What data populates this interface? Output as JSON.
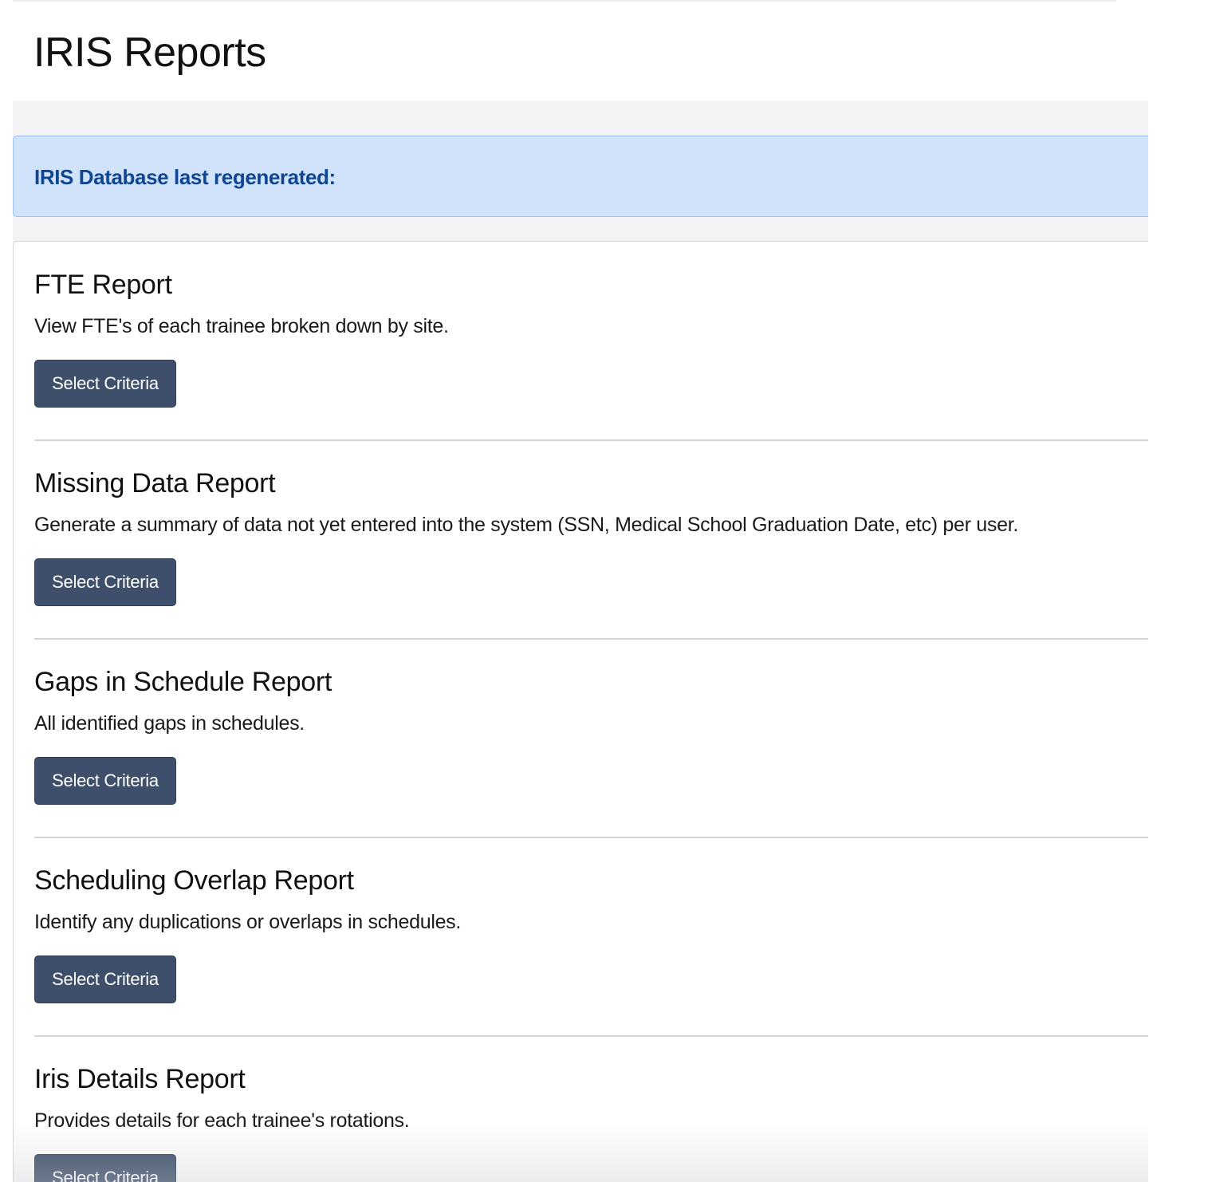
{
  "header": {
    "title": "IRIS Reports"
  },
  "alert": {
    "text": "IRIS Database last regenerated:"
  },
  "reports": [
    {
      "title": "FTE Report",
      "description": "View FTE's of each trainee broken down by site.",
      "button_label": "Select Criteria"
    },
    {
      "title": "Missing Data Report",
      "description": "Generate a summary of data not yet entered into the system (SSN, Medical School Graduation Date, etc) per user.",
      "button_label": "Select Criteria"
    },
    {
      "title": "Gaps in Schedule Report",
      "description": "All identified gaps in schedules.",
      "button_label": "Select Criteria"
    },
    {
      "title": "Scheduling Overlap Report",
      "description": "Identify any duplications or overlaps in schedules.",
      "button_label": "Select Criteria"
    },
    {
      "title": "Iris Details Report",
      "description": "Provides details for each trainee's rotations.",
      "button_label": "Select Criteria"
    }
  ],
  "colors": {
    "button_bg": "#3d4f6a",
    "alert_bg": "#d1e2fb",
    "alert_text": "#0f4591",
    "page_bg": "#f3f3f5"
  }
}
